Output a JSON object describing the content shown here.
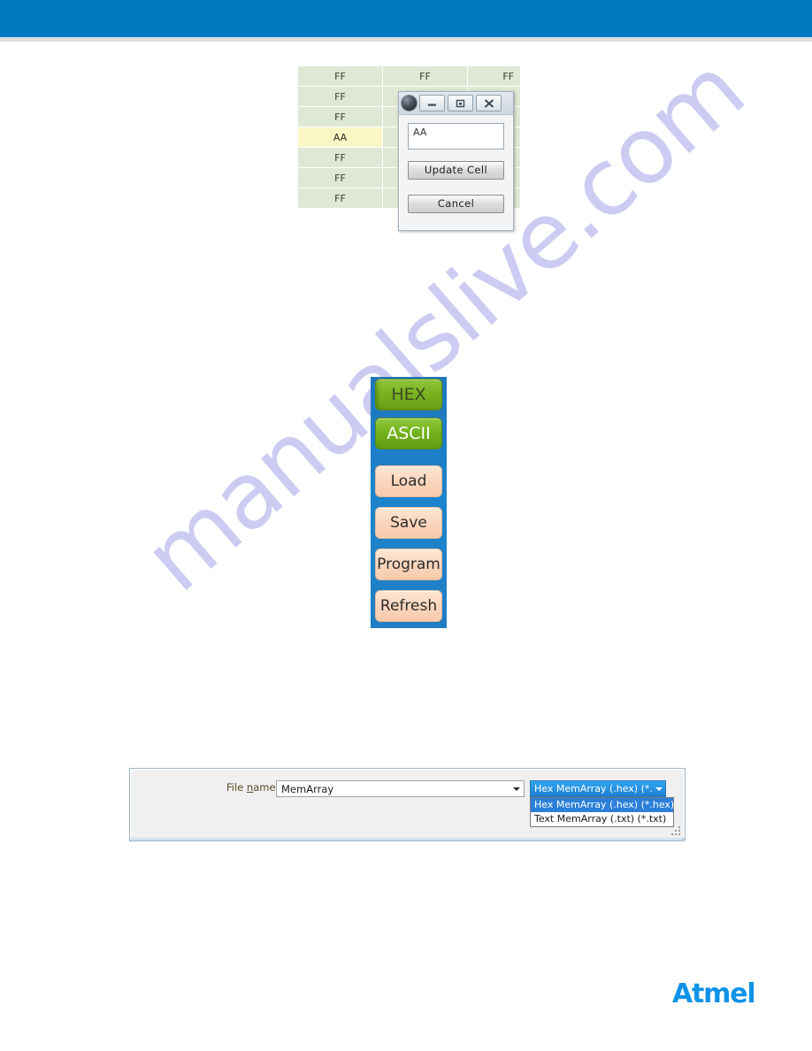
{
  "page": {
    "brand": "Atmel",
    "watermark": "manualslive.com",
    "header_color": "#0079c1",
    "brand_color": "#0e93e8"
  },
  "hex_grid": {
    "selected_value": "AA",
    "rows": [
      {
        "cells": [
          "FF",
          "FF",
          "FF"
        ]
      },
      {
        "cells": [
          "FF",
          "",
          ""
        ]
      },
      {
        "cells": [
          "FF",
          "",
          ""
        ]
      },
      {
        "cells": [
          "AA",
          "",
          ""
        ]
      },
      {
        "cells": [
          "FF",
          "",
          ""
        ]
      },
      {
        "cells": [
          "FF",
          "",
          ""
        ]
      },
      {
        "cells": [
          "FF",
          "",
          ""
        ]
      }
    ]
  },
  "cell_dialog": {
    "app_icon": "app-globe-icon",
    "minimize_icon": "minimize-icon",
    "maximize_icon": "maximize-icon",
    "close_icon": "close-icon",
    "input_value": "AA",
    "update_label": "Update Cell",
    "cancel_label": "Cancel"
  },
  "toolbar": {
    "buttons": [
      {
        "label": "HEX",
        "style": "green-selected"
      },
      {
        "label": "ASCII",
        "style": "green"
      },
      {
        "label": "Load",
        "style": "peach"
      },
      {
        "label": "Save",
        "style": "peach"
      },
      {
        "label": "Program",
        "style": "peach"
      },
      {
        "label": "Refresh",
        "style": "peach"
      }
    ]
  },
  "file_dialog": {
    "filename_label_pre": "File ",
    "filename_label_accel": "n",
    "filename_label_post": "ame:",
    "filename_value": "MemArray",
    "filter_selected": "Hex MemArray (.hex) (*.hex)",
    "filter_options": [
      "Hex MemArray (.hex) (*.hex)",
      "Text MemArray (.txt) (*.txt)"
    ]
  }
}
